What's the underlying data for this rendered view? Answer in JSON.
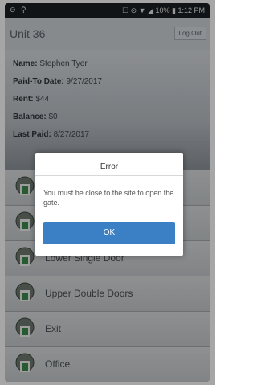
{
  "status_bar": {
    "left_icons": "⊖ ⚲",
    "right_text": "☐ ⊙ ▼ ◢ 10% ▮ 1:12 PM"
  },
  "header": {
    "title": "Unit 36",
    "logout_label": "Log Out"
  },
  "tenant": {
    "name_label": "Name:",
    "name_value": "Stephen Tyer",
    "paid_to_label": "Paid-To Date:",
    "paid_to_value": "9/27/2017",
    "rent_label": "Rent:",
    "rent_value": "$44",
    "balance_label": "Balance:",
    "balance_value": "$0",
    "last_paid_label": "Last Paid:",
    "last_paid_value": "8/27/2017"
  },
  "doors": [
    {
      "label": "",
      "icon": "gate-icon"
    },
    {
      "label": "",
      "icon": "gate-icon"
    },
    {
      "label": "Lower Single Door",
      "icon": "gate-icon"
    },
    {
      "label": "Upper Double Doors",
      "icon": "gate-icon"
    },
    {
      "label": "Exit",
      "icon": "gate-icon"
    },
    {
      "label": "Office",
      "icon": "gate-icon"
    }
  ],
  "dialog": {
    "title": "Error",
    "message": "You must be close to the site to open the gate.",
    "ok_label": "OK"
  },
  "colors": {
    "ok_button": "#3b7fc4",
    "app_bar": "#cfd4d8"
  }
}
